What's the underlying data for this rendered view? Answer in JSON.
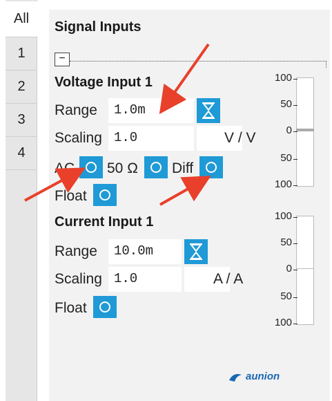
{
  "tabs": [
    {
      "label": "All",
      "active": true
    },
    {
      "label": "1",
      "active": false
    },
    {
      "label": "2",
      "active": false
    },
    {
      "label": "3",
      "active": false
    },
    {
      "label": "4",
      "active": false
    }
  ],
  "panel": {
    "title": "Signal Inputs",
    "collapse_symbol": "−"
  },
  "voltage": {
    "title": "Voltage Input 1",
    "range_label": "Range",
    "range_value": "1.0m",
    "scaling_label": "Scaling",
    "scaling_value": "1.0",
    "unit": "V / V",
    "ac_label": "AC",
    "ohm_label": "50 Ω",
    "diff_label": "Diff",
    "float_label": "Float",
    "meter_ticks": [
      "100",
      "50",
      "0",
      "50",
      "100"
    ]
  },
  "current": {
    "title": "Current Input 1",
    "range_label": "Range",
    "range_value": "10.0m",
    "scaling_label": "Scaling",
    "scaling_value": "1.0",
    "unit": "A / A",
    "float_label": "Float",
    "meter_ticks": [
      "100",
      "50",
      "0",
      "50",
      "100"
    ]
  },
  "watermark": "aunion",
  "colors": {
    "accent": "#1f9ad6",
    "arrow": "#e8402a",
    "panel_bg": "#f2f2f2"
  }
}
